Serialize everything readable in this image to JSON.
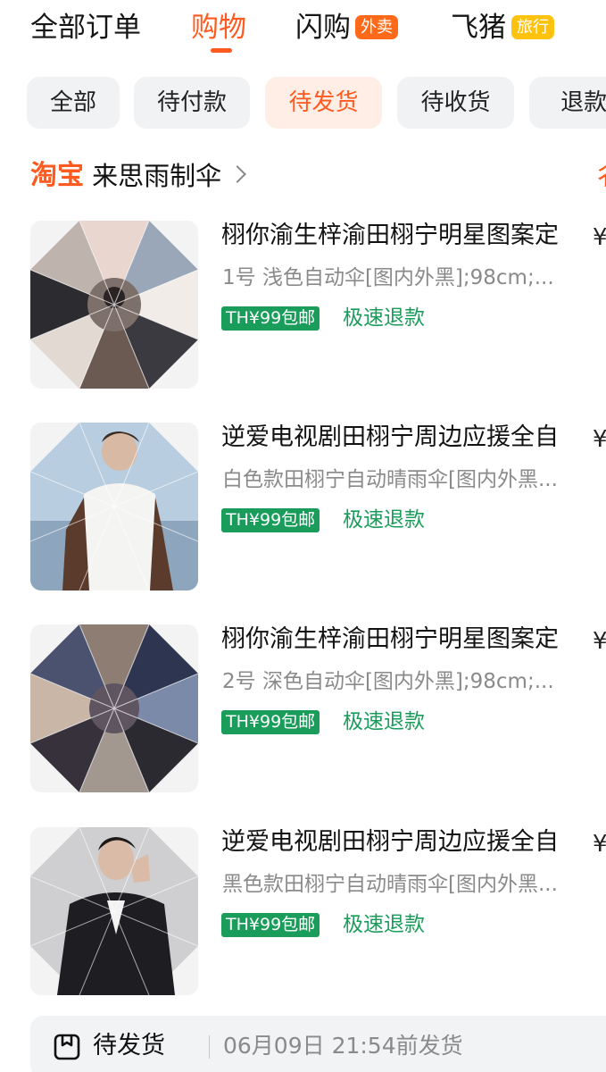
{
  "top_tabs": [
    {
      "label": "全部订单"
    },
    {
      "label": "购物",
      "active": true
    },
    {
      "label": "闪购",
      "badge": "外卖"
    },
    {
      "label": "飞猪",
      "badge": "旅行"
    }
  ],
  "filters": [
    {
      "label": "全部"
    },
    {
      "label": "待付款"
    },
    {
      "label": "待发货",
      "active": true
    },
    {
      "label": "待收货"
    },
    {
      "label": "退款/"
    }
  ],
  "shop": {
    "brand": "淘宝",
    "name": "来思雨制伞"
  },
  "items": [
    {
      "title": "栩你渝生梓渝田栩宁明星图案定",
      "spec": "1号 浅色自动伞[图内外黑];98cm;...",
      "tag": "TH¥99包邮",
      "refund": "极速退款",
      "thumb_icon": "collage-photo-icon"
    },
    {
      "title": "逆爱电视剧田栩宁周边应援全自",
      "spec": "白色款田栩宁自动晴雨伞[图内外黑...",
      "tag": "TH¥99包邮",
      "refund": "极速退款",
      "thumb_icon": "portrait-photo-icon"
    },
    {
      "title": "栩你渝生梓渝田栩宁明星图案定",
      "spec": "2号 深色自动伞[图内外黑];98cm;...",
      "tag": "TH¥99包邮",
      "refund": "极速退款",
      "thumb_icon": "collage-photo-icon"
    },
    {
      "title": "逆爱电视剧田栩宁周边应援全自",
      "spec": "黑色款田栩宁自动晴雨伞[图内外黑...",
      "tag": "TH¥99包邮",
      "refund": "极速退款",
      "thumb_icon": "portrait-photo-icon"
    }
  ],
  "bottom_bar": {
    "status": "待发货",
    "time": "06月09日 21:54前发货",
    "icon": "package-icon"
  },
  "colors": {
    "accent": "#ff5a1f",
    "green": "#1a9d5b",
    "chip_bg": "#f1f2f4",
    "chip_active_bg": "#ffeee6"
  }
}
